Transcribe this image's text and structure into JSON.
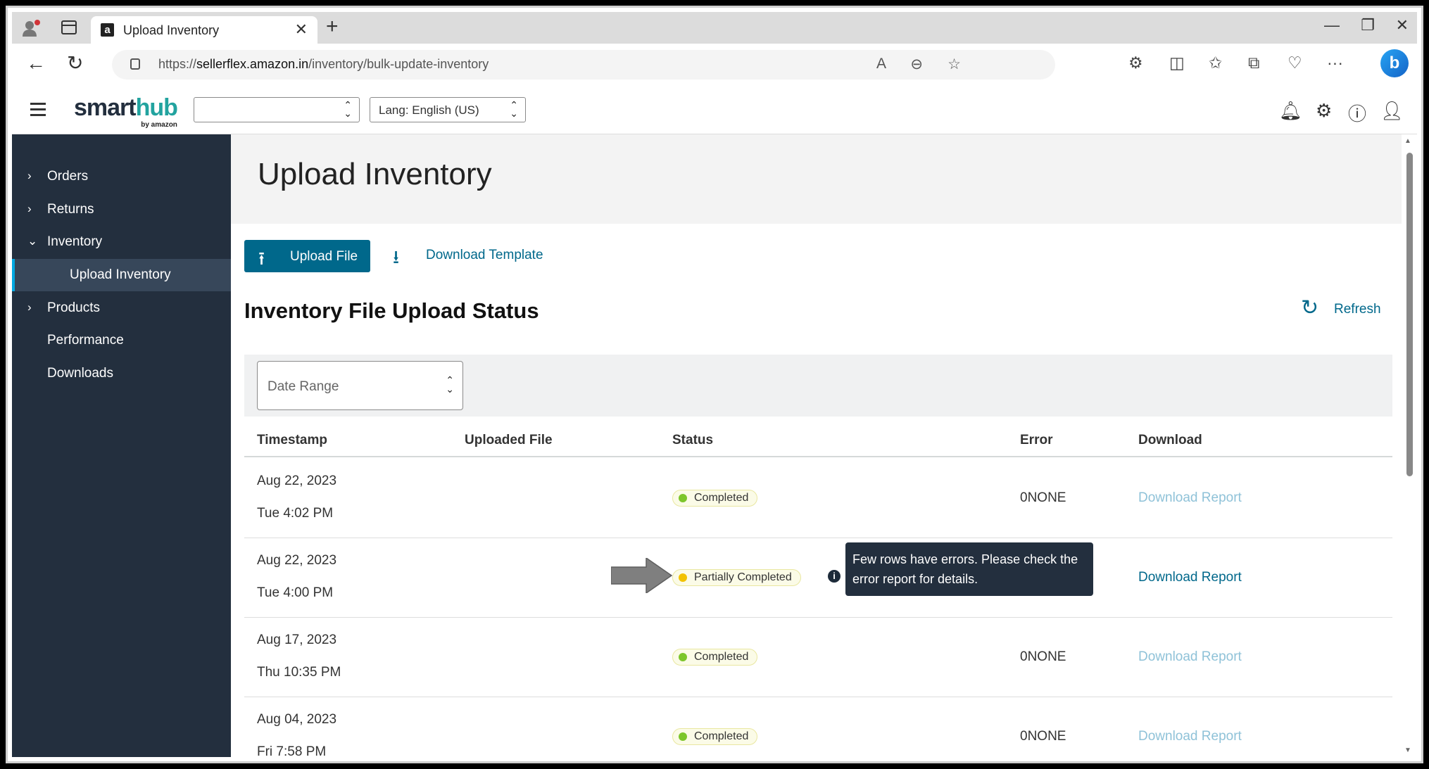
{
  "browser": {
    "tab_title": "Upload Inventory",
    "favicon_letter": "a",
    "url_prefix": "https://",
    "url_host": "sellerflex.amazon.in",
    "url_path": "/inventory/bulk-update-inventory"
  },
  "app": {
    "logo_main": "smart",
    "logo_accent": "hub",
    "logo_by": "by amazon",
    "store_select_value": "",
    "lang_select_value": "Lang: English (US)"
  },
  "sidebar": {
    "items": [
      {
        "label": "Orders"
      },
      {
        "label": "Returns"
      },
      {
        "label": "Inventory"
      },
      {
        "label": "Upload Inventory"
      },
      {
        "label": "Products"
      },
      {
        "label": "Performance"
      },
      {
        "label": "Downloads"
      }
    ]
  },
  "main": {
    "page_title": "Upload Inventory",
    "upload_button": "Upload File",
    "download_template": "Download Template",
    "section_title": "Inventory File Upload Status",
    "refresh": "Refresh",
    "date_range": "Date Range",
    "columns": [
      "Timestamp",
      "Uploaded File",
      "Status",
      "Error",
      "Download"
    ],
    "rows": [
      {
        "date": "Aug 22, 2023",
        "time": "Tue 4:02 PM",
        "status": "Completed",
        "error": "0NONE",
        "download": "Download Report"
      },
      {
        "date": "Aug 22, 2023",
        "time": "Tue 4:00 PM",
        "status": "Partially Completed",
        "error": "",
        "download": "Download Report"
      },
      {
        "date": "Aug 17, 2023",
        "time": "Thu 10:35 PM",
        "status": "Completed",
        "error": "0NONE",
        "download": "Download Report"
      },
      {
        "date": "Aug 04, 2023",
        "time": "Fri 7:58 PM",
        "status": "Completed",
        "error": "0NONE",
        "download": "Download Report"
      }
    ],
    "tooltip": "Few rows have errors. Please check the error report for details.",
    "info_glyph": "i"
  },
  "colors": {
    "sidebar_bg": "#232f3e",
    "accent": "#00688b",
    "completed_dot": "#7dc62b",
    "partial_dot": "#f2c200"
  }
}
